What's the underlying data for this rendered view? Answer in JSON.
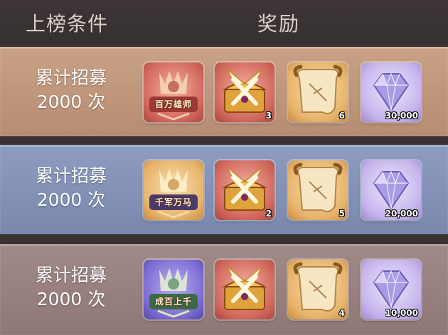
{
  "header": {
    "condition_label": "上榜条件",
    "reward_label": "奖励"
  },
  "rows": [
    {
      "theme": "gold",
      "condition": [
        "累计招募",
        "2000 次"
      ],
      "badge": {
        "title": "百万雄师",
        "icon": "title-badge-icon",
        "color": "#d86b5e"
      },
      "chest_qty": "3",
      "scroll_qty": "6",
      "gem_qty": "30,000"
    },
    {
      "theme": "blue",
      "condition": [
        "累计招募",
        "2000 次"
      ],
      "badge": {
        "title": "千军万马",
        "icon": "title-badge-icon",
        "color": "#e8b56c"
      },
      "chest_qty": "2",
      "scroll_qty": "5",
      "gem_qty": "20,000"
    },
    {
      "theme": "mauve",
      "condition": [
        "累计招募",
        "2000 次"
      ],
      "badge": {
        "title": "成百上千",
        "icon": "title-badge-icon",
        "color": "#7c6bd4"
      },
      "chest_qty": "",
      "scroll_qty": "4",
      "gem_qty": "10,000"
    }
  ],
  "icons": {
    "chest": "winged-treasure-chest-icon",
    "scroll": "ancient-scroll-icon",
    "gem": "diamond-gem-icon"
  }
}
